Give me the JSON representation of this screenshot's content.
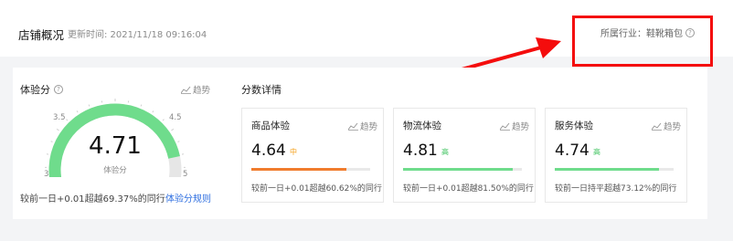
{
  "header": {
    "title": "店铺概况",
    "update_time": "更新时间: 2021/11/18 09:16:04",
    "industry": "所属行业：鞋靴箱包",
    "help_icon": "question-circle-icon"
  },
  "annotation": {
    "color": "#f40d0d"
  },
  "experience": {
    "title": "体验分",
    "trend_label": "趋势",
    "score": "4.71",
    "caption": "体验分",
    "gauge": {
      "min": 3,
      "max": 5,
      "value": 4.71,
      "ticks": [
        "3",
        "3.5",
        "4.5",
        "5"
      ],
      "fill_color": "#6fdc8c",
      "track_color": "#e6e6e6"
    },
    "compare": "较前一日+0.01超越69.37%的同行",
    "rules_link": "体验分规则"
  },
  "details": {
    "title": "分数详情",
    "cards": [
      {
        "name": "商品体验",
        "trend_label": "趋势",
        "score": "4.64",
        "level": "中",
        "level_color": "#f5a01a",
        "bar_color": "#f07c2e",
        "progress": 0.8,
        "note": "较前一日+0.01超越60.62%的同行"
      },
      {
        "name": "物流体验",
        "trend_label": "趋势",
        "score": "4.81",
        "level": "高",
        "level_color": "#3fc35f",
        "bar_color": "#6fdc8c",
        "progress": 0.92,
        "note": "较前一日+0.01超越81.50%的同行"
      },
      {
        "name": "服务体验",
        "trend_label": "趋势",
        "score": "4.74",
        "level": "高",
        "level_color": "#3fc35f",
        "bar_color": "#6fdc8c",
        "progress": 0.88,
        "note": "较前一日持平超越73.12%的同行"
      }
    ]
  }
}
